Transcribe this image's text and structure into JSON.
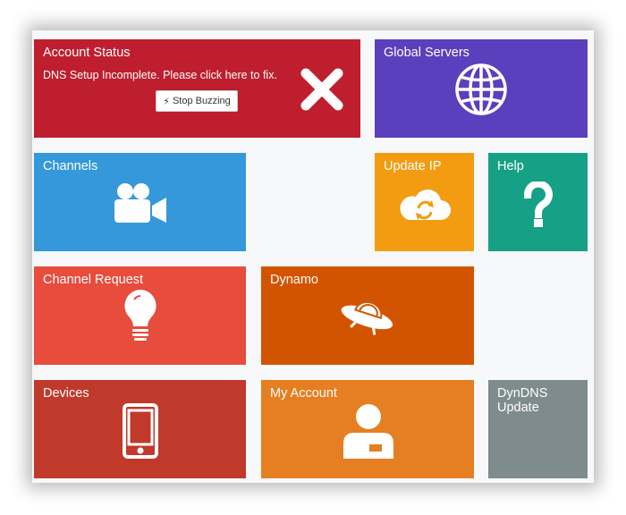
{
  "tiles": {
    "account_status": {
      "title": "Account Status",
      "message": "DNS Setup Incomplete. Please click here to fix.",
      "button_label": "Stop Buzzing",
      "button_icon": "lightning-bolt-icon",
      "status_icon": "close-x-icon",
      "color": "#bf1e2e"
    },
    "global_servers": {
      "title": "Global Servers",
      "icon": "globe-icon",
      "color": "#5b3fbd"
    },
    "channels": {
      "title": "Channels",
      "icon": "video-camera-icon",
      "color": "#3498db"
    },
    "update_ip": {
      "title": "Update IP",
      "icon": "cloud-refresh-icon",
      "color": "#f39c12"
    },
    "help": {
      "title": "Help",
      "icon": "question-mark-icon",
      "color": "#16a085"
    },
    "channel_request": {
      "title": "Channel Request",
      "icon": "lightbulb-icon",
      "color": "#e74c3c"
    },
    "dynamo": {
      "title": "Dynamo",
      "icon": "ufo-icon",
      "color": "#d35400"
    },
    "devices": {
      "title": "Devices",
      "icon": "mobile-phone-icon",
      "color": "#c0392b"
    },
    "my_account": {
      "title": "My Account",
      "icon": "user-icon",
      "color": "#e67e22"
    },
    "dyndns_update": {
      "title_line1": "DynDNS",
      "title_line2": "Update",
      "color": "#7f8c8d"
    }
  }
}
